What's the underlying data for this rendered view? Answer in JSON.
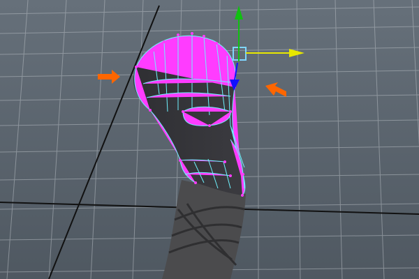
{
  "viewport": {
    "background_top": "#66707a",
    "background_bottom": "#4f5861",
    "grid_color": "#b6bcc2",
    "axis_line_color": "#111111"
  },
  "mesh": {
    "fill": "#2f2f33",
    "fill_light": "#3b3b40",
    "wire_color": "#6ff3ff",
    "vertex_color": "#ff3cff"
  },
  "manipulator": {
    "x_axis_color": "#e8e800",
    "y_axis_color": "#10c010",
    "z_axis_color": "#1010ff",
    "pivot_color": "#7fd7ff"
  },
  "annotations": {
    "arrow_color": "#ff6600",
    "icons": [
      "orange-arrow-icon",
      "orange-arrow-icon"
    ]
  },
  "lower_body": {
    "fill": "#4b4b4d",
    "wrap_line_color": "#2c2c2e"
  }
}
